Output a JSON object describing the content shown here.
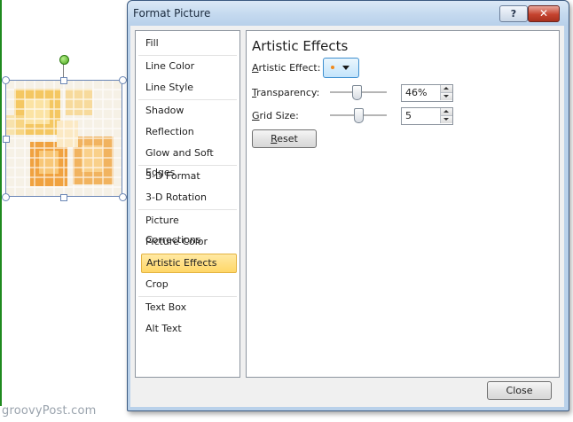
{
  "dialog": {
    "title": "Format Picture",
    "help_glyph": "?",
    "close_glyph": "✕",
    "close_button_label": "Close"
  },
  "nav": {
    "items": [
      {
        "label": "Fill"
      },
      {
        "label": "Line Color"
      },
      {
        "label": "Line Style"
      },
      {
        "label": "Shadow"
      },
      {
        "label": "Reflection"
      },
      {
        "label": "Glow and Soft Edges"
      },
      {
        "label": "3-D Format"
      },
      {
        "label": "3-D Rotation"
      },
      {
        "label": "Picture Corrections"
      },
      {
        "label": "Picture Color"
      },
      {
        "label": "Artistic Effects",
        "selected": true
      },
      {
        "label": "Crop"
      },
      {
        "label": "Text Box"
      },
      {
        "label": "Alt Text"
      }
    ]
  },
  "panel": {
    "title": "Artistic Effects",
    "artistic_effect": {
      "label_accel": "A",
      "label_rest": "rtistic Effect:"
    },
    "transparency": {
      "label_accel": "T",
      "label_rest": "ransparency:",
      "value": "46%",
      "fraction": 0.46
    },
    "grid_size": {
      "label_accel": "G",
      "label_rest": "rid Size:",
      "value": "5",
      "fraction": 0.5
    },
    "reset": {
      "label_accel": "R",
      "label_rest": "eset"
    }
  },
  "watermark": "groovyPost.com",
  "colors": {
    "accent_selected": "#ffd767",
    "title_close": "#c5432f",
    "effect_dot": "#f18a1b"
  }
}
